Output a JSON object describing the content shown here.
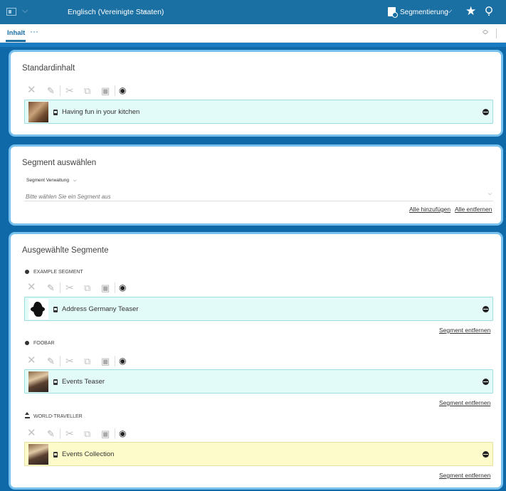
{
  "topbar": {
    "language": "Englisch (Vereinigte Staaten)",
    "segmentation_label": "Segmentierung"
  },
  "tabs": {
    "active_label": "Inhalt",
    "more_label": "···"
  },
  "default_content": {
    "title": "Standardinhalt",
    "item": {
      "label": "Having fun in your kitchen",
      "thumbnail": "kitchen-photo"
    }
  },
  "select_segment": {
    "title": "Segment auswählen",
    "dropdown_label": "Segment Verwaltung",
    "placeholder": "Bitte wählen Sie ein Segment aus",
    "add_all": "Alle hinzufügen",
    "remove_all": "Alle entfernen"
  },
  "selected_segments": {
    "title": "Ausgewählte Segmente",
    "remove_label": "Segment entfernen",
    "segments": [
      {
        "name": "EXAMPLE SEGMENT",
        "icon": "dot-icon",
        "item_label": "Address Germany Teaser",
        "color": "#e2fbf8"
      },
      {
        "name": "FOOBAR",
        "icon": "dot-icon",
        "item_label": "Events Teaser",
        "color": "#e2fbf8"
      },
      {
        "name": "WORLD-TRAVELLER",
        "icon": "house-icon",
        "item_label": "Events Collection",
        "color": "#fdfbc9"
      }
    ]
  },
  "colors": {
    "brand_blue": "#1a6fa3",
    "card_border": "#77c1ee",
    "item_teal": "#e2fbf8",
    "item_yellow": "#fdfbc9"
  }
}
